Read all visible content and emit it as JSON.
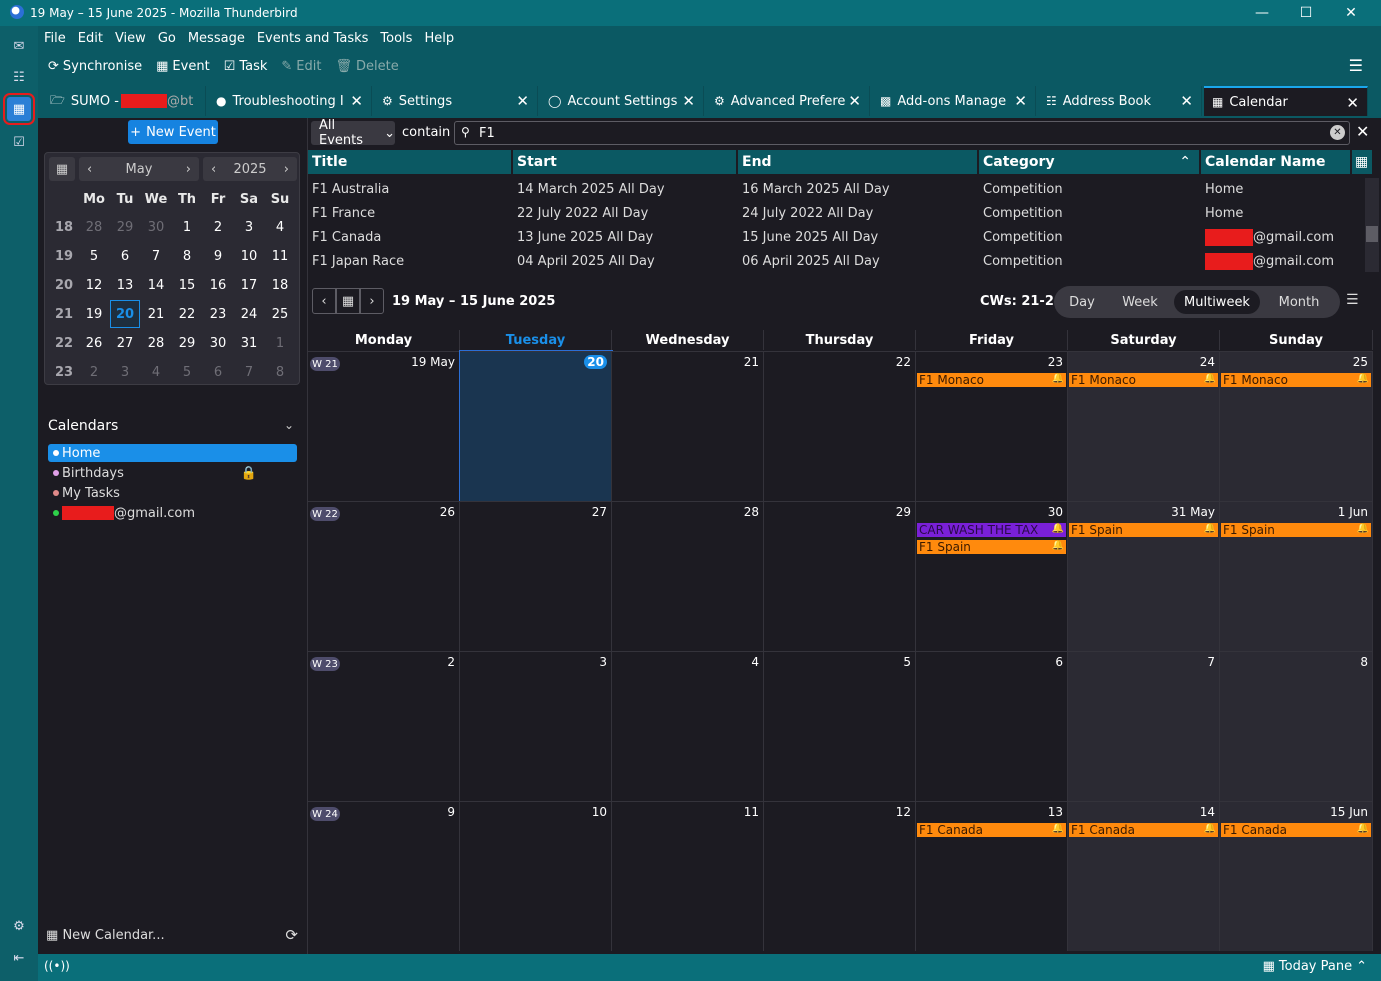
{
  "window": {
    "title": "19 May – 15 June 2025 - Mozilla Thunderbird"
  },
  "menubar": [
    "File",
    "Edit",
    "View",
    "Go",
    "Message",
    "Events and Tasks",
    "Tools",
    "Help"
  ],
  "toolbar": {
    "sync": "Synchronise",
    "event": "Event",
    "task": "Task",
    "edit": "Edit",
    "delete": "Delete"
  },
  "tabs": [
    {
      "label": "SUMO -",
      "suffix": "@bt"
    },
    {
      "label": "Troubleshooting I"
    },
    {
      "label": "Settings"
    },
    {
      "label": "Account Settings"
    },
    {
      "label": "Advanced Prefere"
    },
    {
      "label": "Add-ons Manage"
    },
    {
      "label": "Address Book"
    },
    {
      "label": "Calendar"
    }
  ],
  "new_event": "New Event",
  "minimonth": {
    "month": "May",
    "year": "2025",
    "weekday_headers": [
      "Mo",
      "Tu",
      "We",
      "Th",
      "Fr",
      "Sa",
      "Su"
    ],
    "weeks": [
      {
        "wk": "18",
        "days": [
          "28",
          "29",
          "30",
          "1",
          "2",
          "3",
          "4"
        ],
        "dim": [
          true,
          true,
          true,
          false,
          false,
          false,
          false
        ]
      },
      {
        "wk": "19",
        "days": [
          "5",
          "6",
          "7",
          "8",
          "9",
          "10",
          "11"
        ],
        "dim": [
          false,
          false,
          false,
          false,
          false,
          false,
          false
        ]
      },
      {
        "wk": "20",
        "days": [
          "12",
          "13",
          "14",
          "15",
          "16",
          "17",
          "18"
        ],
        "dim": [
          false,
          false,
          false,
          false,
          false,
          false,
          false
        ]
      },
      {
        "wk": "21",
        "days": [
          "19",
          "20",
          "21",
          "22",
          "23",
          "24",
          "25"
        ],
        "dim": [
          false,
          false,
          false,
          false,
          false,
          false,
          false
        ]
      },
      {
        "wk": "22",
        "days": [
          "26",
          "27",
          "28",
          "29",
          "30",
          "31",
          "1"
        ],
        "dim": [
          false,
          false,
          false,
          false,
          false,
          false,
          true
        ]
      },
      {
        "wk": "23",
        "days": [
          "2",
          "3",
          "4",
          "5",
          "6",
          "7",
          "8"
        ],
        "dim": [
          true,
          true,
          true,
          true,
          true,
          true,
          true
        ]
      }
    ],
    "today": "20"
  },
  "calendars": {
    "title": "Calendars",
    "items": [
      {
        "name": "Home",
        "color": "#1a8fe8"
      },
      {
        "name": "Birthdays",
        "color": "#e0a0e8"
      },
      {
        "name": "My Tasks",
        "color": "#e08a8a"
      },
      {
        "name": "@gmail.com",
        "color": "#2ed24a"
      }
    ],
    "new_calendar": "New Calendar..."
  },
  "search": {
    "filter": "All Events",
    "contain": "contain",
    "query": "F1"
  },
  "tree": {
    "columns": [
      "Title",
      "Start",
      "End",
      "Category",
      "Calendar Name"
    ],
    "rows": [
      [
        "F1 Australia",
        "14 March 2025 All Day",
        "16 March 2025 All Day",
        "Competition",
        "Home"
      ],
      [
        "F1 France",
        "22 July 2022 All Day",
        "24 July 2022 All Day",
        "Competition",
        "Home"
      ],
      [
        "F1 Canada",
        "13 June 2025 All Day",
        "15 June 2025 All Day",
        "Competition",
        "@gmail.com"
      ],
      [
        "F1 Japan Race",
        "04 April 2025 All Day",
        "06 April 2025 All Day",
        "Competition",
        "@gmail.com"
      ]
    ]
  },
  "nav": {
    "range": "19 May – 15 June 2025",
    "cw": "CWs: 21-24"
  },
  "views": [
    "Day",
    "Week",
    "Multiweek",
    "Month"
  ],
  "grid": {
    "columns": [
      "Monday",
      "Tuesday",
      "Wednesday",
      "Thursday",
      "Friday",
      "Saturday",
      "Sunday"
    ],
    "weeks": [
      {
        "badge": "W 21",
        "days": [
          "19 May",
          "",
          "21",
          "22",
          "23",
          "24",
          "25"
        ]
      },
      {
        "badge": "W 22",
        "days": [
          "26",
          "27",
          "28",
          "29",
          "30",
          "31 May",
          "1 Jun"
        ]
      },
      {
        "badge": "W 23",
        "days": [
          "2",
          "3",
          "4",
          "5",
          "6",
          "7",
          "8"
        ]
      },
      {
        "badge": "W 24",
        "days": [
          "9",
          "10",
          "11",
          "12",
          "13",
          "14",
          "15 Jun"
        ]
      }
    ],
    "today_num": "20",
    "events": {
      "monaco": "F1 Monaco",
      "spain": "F1 Spain",
      "canada": "F1 Canada",
      "purple": "CAR WASH THE TAX"
    }
  },
  "statusbar": {
    "today_pane": "Today Pane"
  },
  "colors": {
    "accent": "#1a8fe8",
    "event_orange": "#ff8a0d",
    "event_purple": "#7a20d8",
    "teal": "#0a6f7a"
  }
}
